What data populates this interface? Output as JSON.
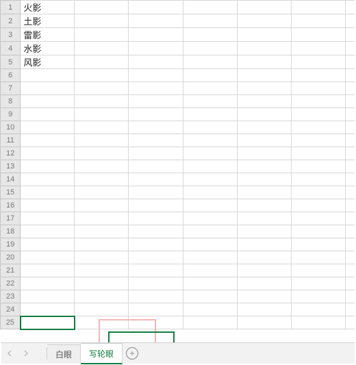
{
  "rows": [
    {
      "n": "1",
      "a": "火影"
    },
    {
      "n": "2",
      "a": "土影"
    },
    {
      "n": "3",
      "a": "雷影"
    },
    {
      "n": "4",
      "a": "水影"
    },
    {
      "n": "5",
      "a": "风影"
    },
    {
      "n": "6",
      "a": ""
    },
    {
      "n": "7",
      "a": ""
    },
    {
      "n": "8",
      "a": ""
    },
    {
      "n": "9",
      "a": ""
    },
    {
      "n": "10",
      "a": ""
    },
    {
      "n": "11",
      "a": ""
    },
    {
      "n": "12",
      "a": ""
    },
    {
      "n": "13",
      "a": ""
    },
    {
      "n": "14",
      "a": ""
    },
    {
      "n": "15",
      "a": ""
    },
    {
      "n": "16",
      "a": ""
    },
    {
      "n": "17",
      "a": ""
    },
    {
      "n": "18",
      "a": ""
    },
    {
      "n": "19",
      "a": ""
    },
    {
      "n": "20",
      "a": ""
    },
    {
      "n": "21",
      "a": ""
    },
    {
      "n": "22",
      "a": ""
    },
    {
      "n": "23",
      "a": ""
    },
    {
      "n": "24",
      "a": ""
    },
    {
      "n": "25",
      "a": ""
    }
  ],
  "selected_cell": "A25",
  "tabs": [
    {
      "label": "白眼",
      "active": false
    },
    {
      "label": "写轮眼",
      "active": true
    }
  ],
  "nav": {
    "prev_enabled": false,
    "next_enabled": false
  },
  "add_tab_glyph": "+"
}
